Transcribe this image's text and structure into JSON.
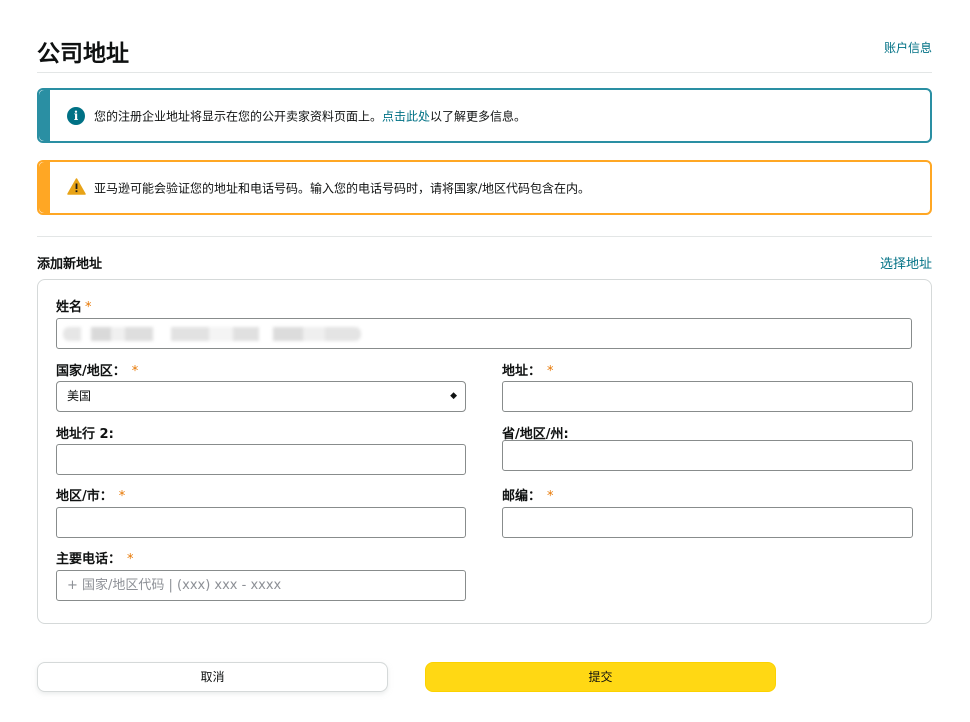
{
  "header": {
    "title": "公司地址",
    "account_link": "账户信息"
  },
  "alerts": {
    "info": {
      "icon": "info-icon",
      "text_before": "您的注册企业地址将显示在您的公开卖家资料页面上。",
      "link": "点击此处",
      "text_after": "以了解更多信息。"
    },
    "warning": {
      "icon": "warning-icon",
      "text": "亚马逊可能会验证您的地址和电话号码。输入您的电话号码时，请将国家/地区代码包含在内。"
    }
  },
  "section": {
    "label": "添加新地址",
    "choose_link": "选择地址"
  },
  "form": {
    "name": {
      "label": "姓名",
      "required": "*",
      "value": ""
    },
    "country": {
      "label": "国家/地区：",
      "required": "*",
      "value": "美国"
    },
    "address": {
      "label": "地址：",
      "required": "*",
      "value": ""
    },
    "address2": {
      "label": "地址行 2:",
      "value": ""
    },
    "province": {
      "label": "省/地区/州:",
      "value": ""
    },
    "city": {
      "label": "地区/市：",
      "required": "*",
      "value": ""
    },
    "postal": {
      "label": "邮编：",
      "required": "*",
      "value": ""
    },
    "phone": {
      "label": "主要电话：",
      "required": "*",
      "value": "",
      "placeholder": "+ 国家/地区代码 | (xxx) xxx - xxxx"
    }
  },
  "buttons": {
    "cancel": "取消",
    "submit": "提交"
  },
  "colors": {
    "link": "#007185",
    "info_accent": "#2a8fa3",
    "warning_accent": "#ffa724",
    "required": "#e77600",
    "submit_bg": "#ffd814"
  }
}
